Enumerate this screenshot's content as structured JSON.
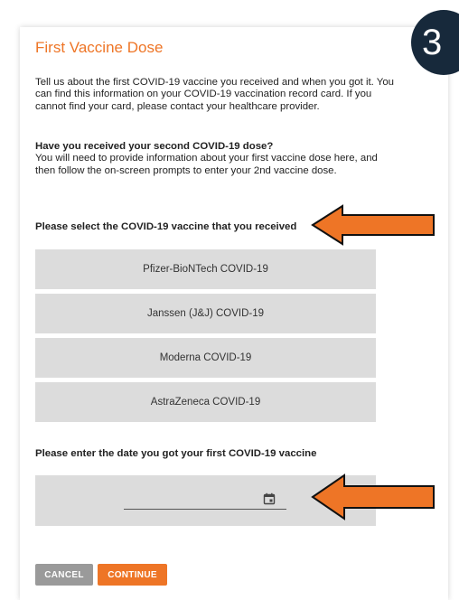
{
  "step": "3",
  "form": {
    "title": "First Vaccine Dose",
    "intro": "Tell us about the first COVID-19 vaccine you received and when you got it. You can find this information on your COVID-19 vaccination record card. If you cannot find your card, please contact your healthcare provider.",
    "second_dose_heading": "Have you received your second COVID-19 dose?",
    "second_dose_text": "You will need to provide information about your first vaccine dose here, and then follow the on-screen prompts to enter your 2nd vaccine dose.",
    "select_label": "Please select the COVID-19 vaccine that you received",
    "vaccines": [
      "Pfizer-BioNTech COVID-19",
      "Janssen (J&J) COVID-19",
      "Moderna COVID-19",
      "AstraZeneca COVID-19"
    ],
    "date_label": "Please enter the date you got your first COVID-19 vaccine",
    "date_value": "",
    "date_icon": "calendar-icon"
  },
  "buttons": {
    "cancel": "CANCEL",
    "continue": "CONTINUE"
  },
  "colors": {
    "accent": "#ee7526",
    "badge": "#17293b",
    "option_bg": "#dcdcdc",
    "cancel_bg": "#9a9a9a"
  }
}
